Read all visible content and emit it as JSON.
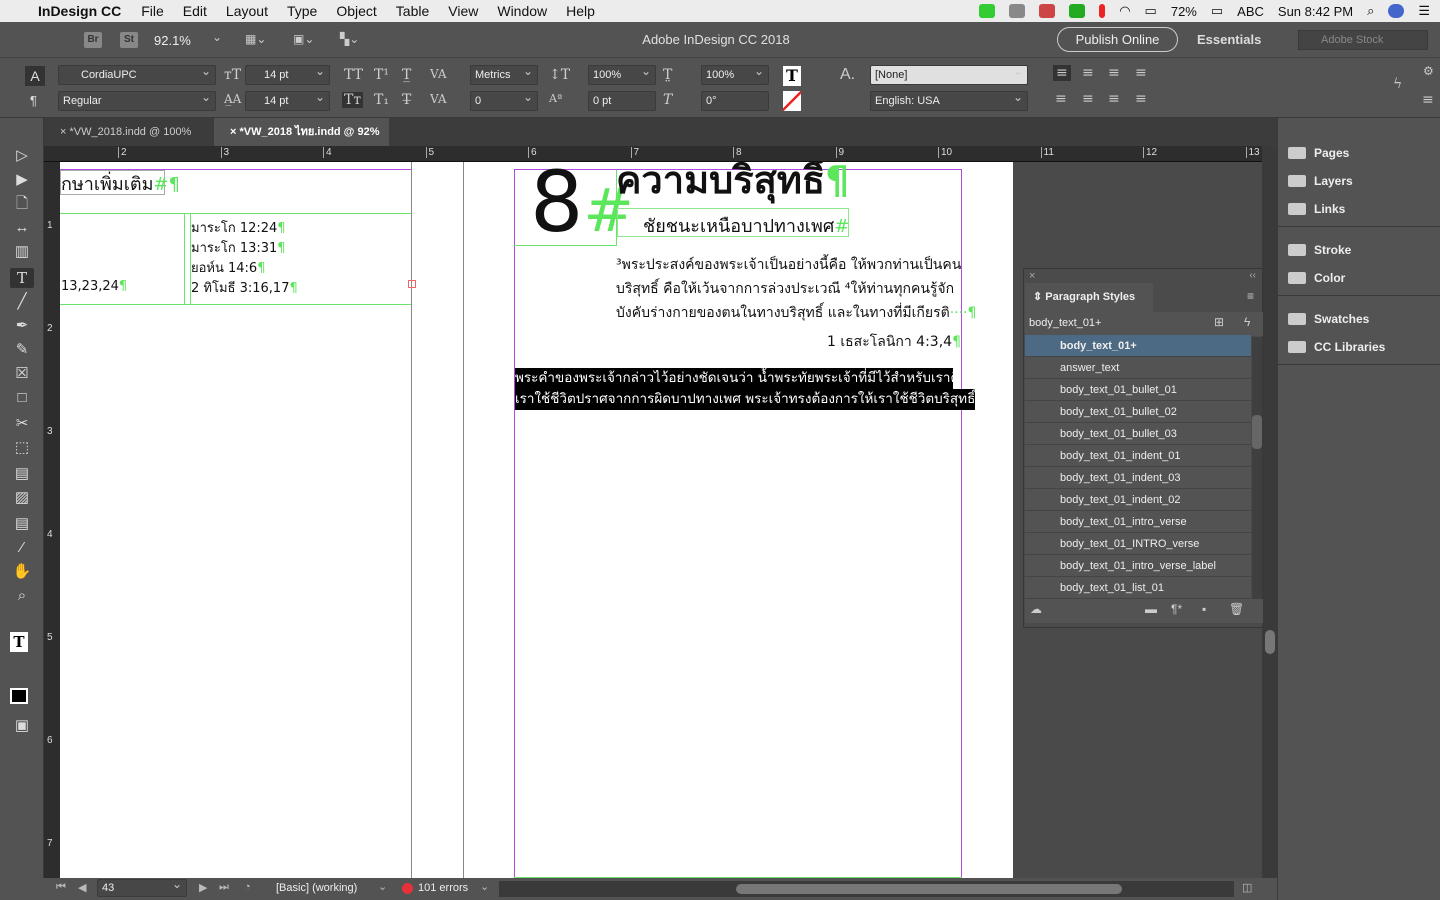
{
  "menubar": {
    "app": "InDesign CC",
    "items": [
      "File",
      "Edit",
      "Layout",
      "Type",
      "Object",
      "Table",
      "View",
      "Window",
      "Help"
    ],
    "battery": "72%",
    "input": "ABC",
    "clock": "Sun 8:42 PM"
  },
  "appbar": {
    "bridge": "Br",
    "stock_btn": "St",
    "zoom": "92.1%",
    "title": "Adobe InDesign CC 2018",
    "publish": "Publish Online",
    "workspace": "Essentials",
    "search_placeholder": "Adobe Stock"
  },
  "control": {
    "font": "CordiaUPC",
    "style": "Regular",
    "size": "14 pt",
    "leading": "14 pt",
    "kerning": "Metrics",
    "tracking": "0",
    "vscale": "100%",
    "hscale": "100%",
    "baseline": "0 pt",
    "skew": "0°",
    "char_style": "[None]",
    "language": "English: USA"
  },
  "tabs": [
    {
      "label": "*VW_2018.indd @ 100%"
    },
    {
      "label": "*VW_2018 ไทย.indd @ 92%"
    }
  ],
  "ruler": {
    "h": [
      "2",
      "3",
      "4",
      "5",
      "6",
      "7",
      "8",
      "9",
      "10",
      "11",
      "12",
      "13"
    ],
    "v": [
      "1",
      "2",
      "3",
      "4",
      "5",
      "6",
      "7"
    ]
  },
  "doc": {
    "left_heading": "กษาเพิ่มเติม",
    "refs": [
      "มาระโก 12:24",
      "มาระโก 13:31",
      "ยอห์น 14:6",
      "2 ทิโมธี 3:16,17"
    ],
    "left_ref": "13,23,24",
    "chapter_num": "8",
    "chapter_title": "ความบริสุทธิ์",
    "subtitle": "ชัยชนะเหนือบาปทางเพศ",
    "verse_lines": [
      "³พระประสงค์ของพระเจ้าเป็นอย่างนี้คือ ให้พวกท่านเป็นคน",
      "บริสุทธิ์ คือให้เว้นจากการล่วงประเวณี ⁴ให้ท่านทุกคนรู้จัก",
      "บังคับร่างกายของตนในทางบริสุทธิ์ และในทางที่มีเกียรติ"
    ],
    "verse_ref": "1 เธสะโลนิกา 4:3,4",
    "selected_lines": [
      "พระคำของพระเจ้ากล่าวไว้อย่างชัดเจนว่า น้ำพระทัยพระเจ้าที่มีไว้สำหรับเราคือให้",
      "เราใช้ชีวิตปราศจากการผิดบาปทางเพศ พระเจ้าทรงต้องการให้เราใช้ชีวิตบริสุทธิ์"
    ]
  },
  "paragraph_styles": {
    "title": "Paragraph Styles",
    "current": "body_text_01+",
    "items": [
      "body_text_01+",
      "answer_text",
      "body_text_01_bullet_01",
      "body_text_01_bullet_02",
      "body_text_01_bullet_03",
      "body_text_01_indent_01",
      "body_text_01_indent_03",
      "body_text_01_indent_02",
      "body_text_01_intro_verse",
      "body_text_01_INTRO_verse",
      "body_text_01_intro_verse_label",
      "body_text_01_list_01"
    ],
    "selected_index": 0
  },
  "dock": {
    "groups": [
      [
        "Pages",
        "Layers",
        "Links"
      ],
      [
        "Stroke",
        "Color"
      ],
      [
        "Swatches",
        "CC Libraries"
      ]
    ]
  },
  "status": {
    "page": "43",
    "preflight_profile": "[Basic] (working)",
    "errors": "101 errors",
    "error_color": "#e8303a"
  },
  "colors": {
    "frame_guide": "#6ce36c",
    "margin_guide": "#b04ae0",
    "selection": "#000000",
    "selected_style": "#4d6a84"
  }
}
